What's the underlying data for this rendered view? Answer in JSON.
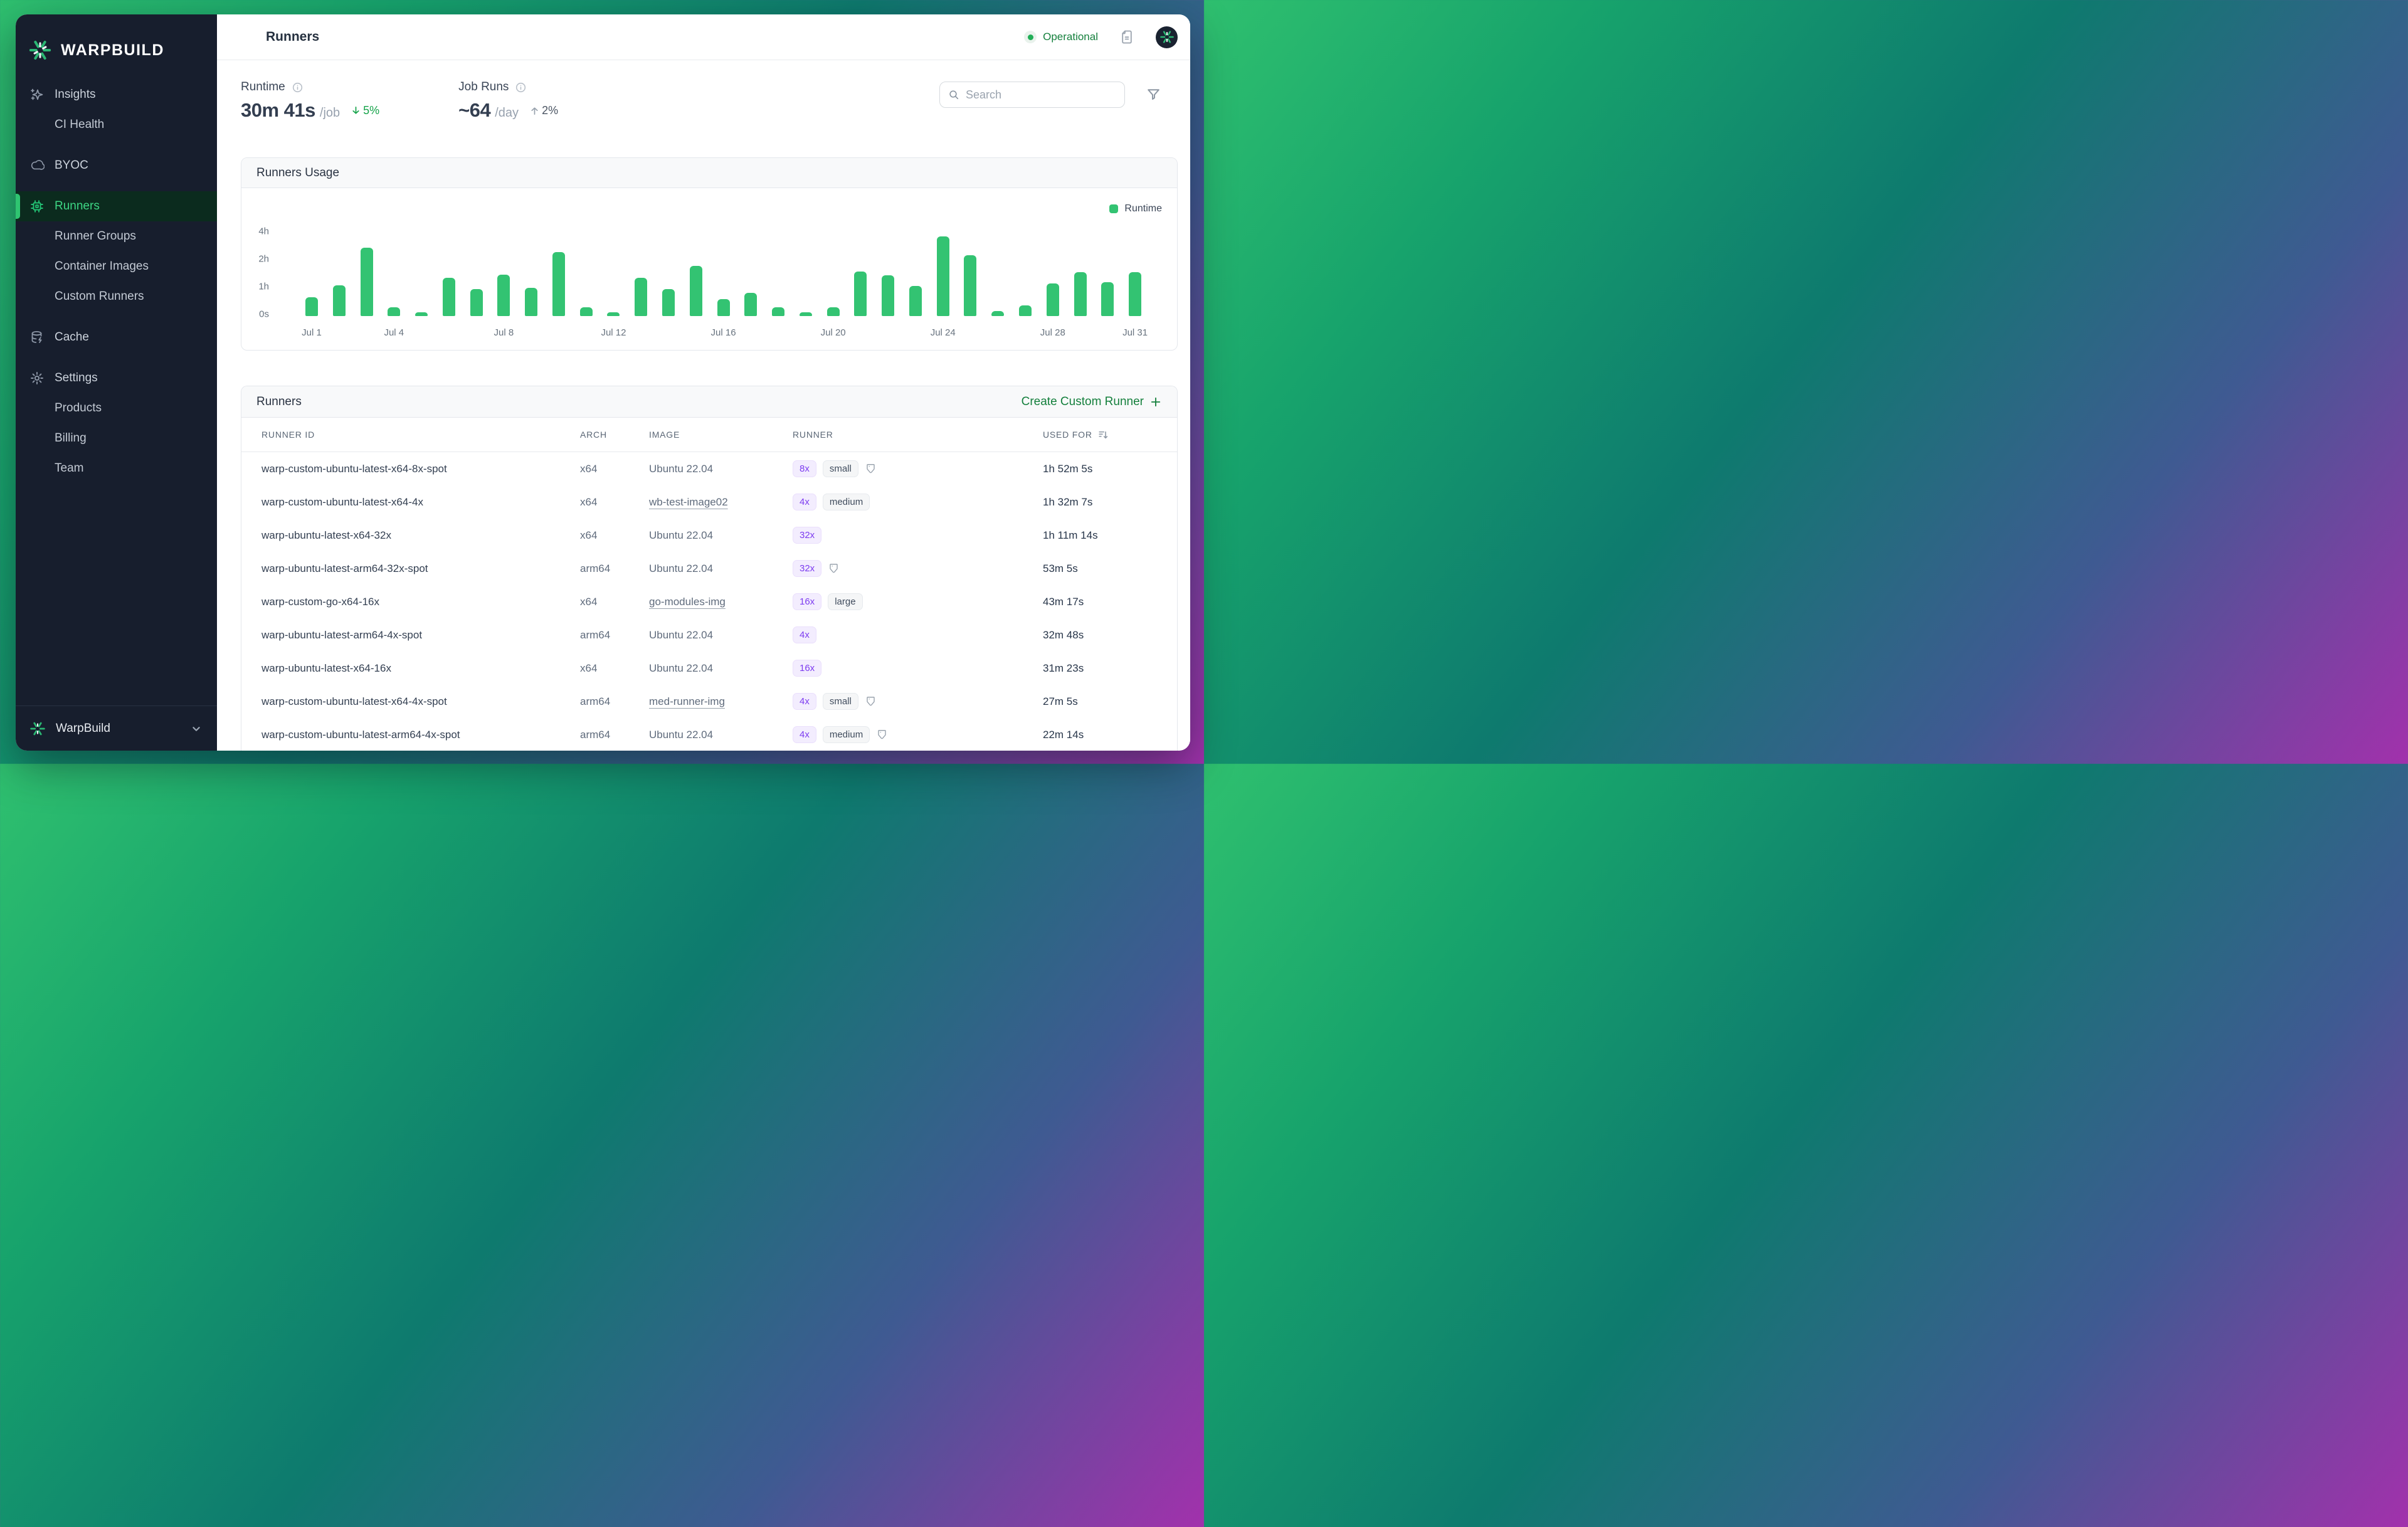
{
  "sidebar": {
    "logo_text": "WARPBUILD",
    "items": [
      {
        "label": "Insights",
        "type": "section",
        "icon": "sparkles-icon"
      },
      {
        "label": "CI Health",
        "type": "sub"
      },
      {
        "label": "BYOC",
        "type": "section",
        "icon": "cloud-icon"
      },
      {
        "label": "Runners",
        "type": "section",
        "icon": "chip-icon",
        "active": true
      },
      {
        "label": "Runner Groups",
        "type": "sub"
      },
      {
        "label": "Container Images",
        "type": "sub"
      },
      {
        "label": "Custom Runners",
        "type": "sub"
      },
      {
        "label": "Cache",
        "type": "section",
        "icon": "database-icon"
      },
      {
        "label": "Settings",
        "type": "section",
        "icon": "gear-icon"
      },
      {
        "label": "Products",
        "type": "sub"
      },
      {
        "label": "Billing",
        "type": "sub"
      },
      {
        "label": "Team",
        "type": "sub"
      }
    ],
    "footer": {
      "label": "WarpBuild"
    }
  },
  "header": {
    "title": "Runners",
    "status": "Operational"
  },
  "stats": {
    "runtime": {
      "label": "Runtime",
      "value": "30m 41s",
      "unit": "/job",
      "delta": "5%",
      "delta_direction": "down"
    },
    "job_runs": {
      "label": "Job Runs",
      "value": "~64",
      "unit": "/day",
      "delta": "2%",
      "delta_direction": "up"
    }
  },
  "search": {
    "placeholder": "Search"
  },
  "chart_card": {
    "title": "Runners Usage",
    "legend": "Runtime"
  },
  "chart_data": {
    "type": "bar",
    "title": "Runners Usage",
    "series_name": "Runtime",
    "unit": "minutes",
    "days": [
      1,
      2,
      3,
      4,
      5,
      6,
      7,
      8,
      9,
      10,
      11,
      12,
      13,
      14,
      15,
      16,
      17,
      18,
      19,
      20,
      21,
      22,
      23,
      24,
      25,
      26,
      27,
      28,
      29,
      30,
      31
    ],
    "values_minutes": [
      41,
      65,
      167,
      19,
      8,
      79,
      59,
      85,
      61,
      150,
      19,
      8,
      79,
      59,
      106,
      37,
      50,
      19,
      8,
      19,
      92,
      84,
      64,
      222,
      138,
      11,
      23,
      68,
      90,
      70,
      90
    ],
    "y_ticks": [
      "0s",
      "1h",
      "2h",
      "4h"
    ],
    "y_scale_note": "ticks 0s/1h/2h/4h are evenly spaced (log2-like above 1h)",
    "x_ticks": [
      {
        "label": "Jul 1",
        "day": 1
      },
      {
        "label": "Jul 4",
        "day": 4
      },
      {
        "label": "Jul 8",
        "day": 8
      },
      {
        "label": "Jul 12",
        "day": 12
      },
      {
        "label": "Jul 16",
        "day": 16
      },
      {
        "label": "Jul 20",
        "day": 20
      },
      {
        "label": "Jul 24",
        "day": 24
      },
      {
        "label": "Jul 28",
        "day": 28
      },
      {
        "label": "Jul 31",
        "day": 31
      }
    ],
    "bar_color": "#33c372",
    "grid": false,
    "legend_position": "top-right"
  },
  "table": {
    "title": "Runners",
    "action_label": "Create Custom Runner",
    "columns": [
      "RUNNER ID",
      "ARCH",
      "IMAGE",
      "RUNNER",
      "USED FOR"
    ],
    "sorted_column": "USED FOR",
    "rows": [
      {
        "runner_id": "warp-custom-ubuntu-latest-x64-8x-spot",
        "arch": "x64",
        "image": "Ubuntu 22.04",
        "image_link": false,
        "multiplier": "8x",
        "size": "small",
        "tag": true,
        "used_for": "1h 52m 5s"
      },
      {
        "runner_id": "warp-custom-ubuntu-latest-x64-4x",
        "arch": "x64",
        "image": "wb-test-image02",
        "image_link": true,
        "multiplier": "4x",
        "size": "medium",
        "tag": false,
        "used_for": "1h 32m 7s"
      },
      {
        "runner_id": "warp-ubuntu-latest-x64-32x",
        "arch": "x64",
        "image": "Ubuntu 22.04",
        "image_link": false,
        "multiplier": "32x",
        "size": null,
        "tag": false,
        "used_for": "1h 11m 14s"
      },
      {
        "runner_id": "warp-ubuntu-latest-arm64-32x-spot",
        "arch": "arm64",
        "image": "Ubuntu 22.04",
        "image_link": false,
        "multiplier": "32x",
        "size": null,
        "tag": true,
        "used_for": "53m 5s"
      },
      {
        "runner_id": "warp-custom-go-x64-16x",
        "arch": "x64",
        "image": "go-modules-img",
        "image_link": true,
        "multiplier": "16x",
        "size": "large",
        "tag": false,
        "used_for": "43m 17s"
      },
      {
        "runner_id": "warp-ubuntu-latest-arm64-4x-spot",
        "arch": "arm64",
        "image": "Ubuntu 22.04",
        "image_link": false,
        "multiplier": "4x",
        "size": null,
        "tag": false,
        "used_for": "32m 48s"
      },
      {
        "runner_id": "warp-ubuntu-latest-x64-16x",
        "arch": "x64",
        "image": "Ubuntu 22.04",
        "image_link": false,
        "multiplier": "16x",
        "size": null,
        "tag": false,
        "used_for": "31m 23s"
      },
      {
        "runner_id": "warp-custom-ubuntu-latest-x64-4x-spot",
        "arch": "arm64",
        "image": "med-runner-img",
        "image_link": true,
        "multiplier": "4x",
        "size": "small",
        "tag": true,
        "used_for": "27m 5s"
      },
      {
        "runner_id": "warp-custom-ubuntu-latest-arm64-4x-spot",
        "arch": "arm64",
        "image": "Ubuntu 22.04",
        "image_link": false,
        "multiplier": "4x",
        "size": "medium",
        "tag": true,
        "used_for": "22m 14s"
      }
    ]
  },
  "colors": {
    "accent_green": "#2fc571",
    "bar_green": "#33c372",
    "status_green": "#15803d",
    "badge_purple_text": "#7d3cf0",
    "badge_purple_bg": "#f3edfe",
    "sidebar_bg": "#171e2d",
    "active_item_bg": "#0b2b1e",
    "active_item_text": "#3dd684"
  }
}
